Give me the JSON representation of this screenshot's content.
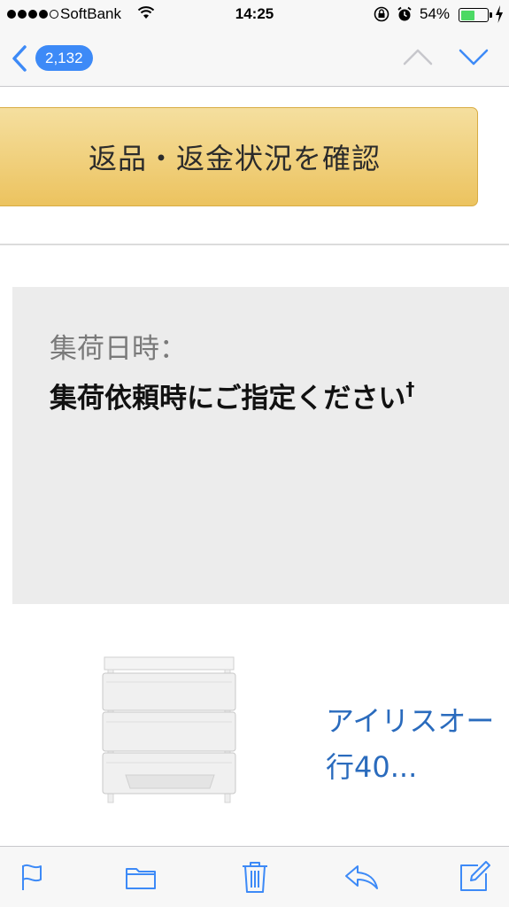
{
  "status_bar": {
    "carrier": "SoftBank",
    "time": "14:25",
    "battery_percent": "54%",
    "battery_level": 0.54,
    "icons": [
      "signal-dots-icon",
      "wifi-icon",
      "orientation-lock-icon",
      "alarm-icon",
      "battery-icon",
      "charging-bolt-icon"
    ]
  },
  "nav": {
    "unread_count": "2,132",
    "icons": [
      "back-chevron-icon",
      "previous-message-icon",
      "next-message-icon"
    ]
  },
  "content": {
    "button_label": "返品・返金状況を確認",
    "pickup_label": "集荷日時：",
    "pickup_value": "集荷依頼時にご指定ください",
    "pickup_mark": "†",
    "product_title_line1": "アイリスオー",
    "product_title_line2": "行40..."
  },
  "toolbar": {
    "icons": [
      "flag-icon",
      "folder-icon",
      "trash-icon",
      "reply-icon",
      "compose-icon"
    ]
  },
  "colors": {
    "accent": "#3d8af7",
    "button_top": "#f5df9f",
    "button_bottom": "#ecc35f",
    "link": "#2a6bbd",
    "battery": "#4cd964"
  }
}
